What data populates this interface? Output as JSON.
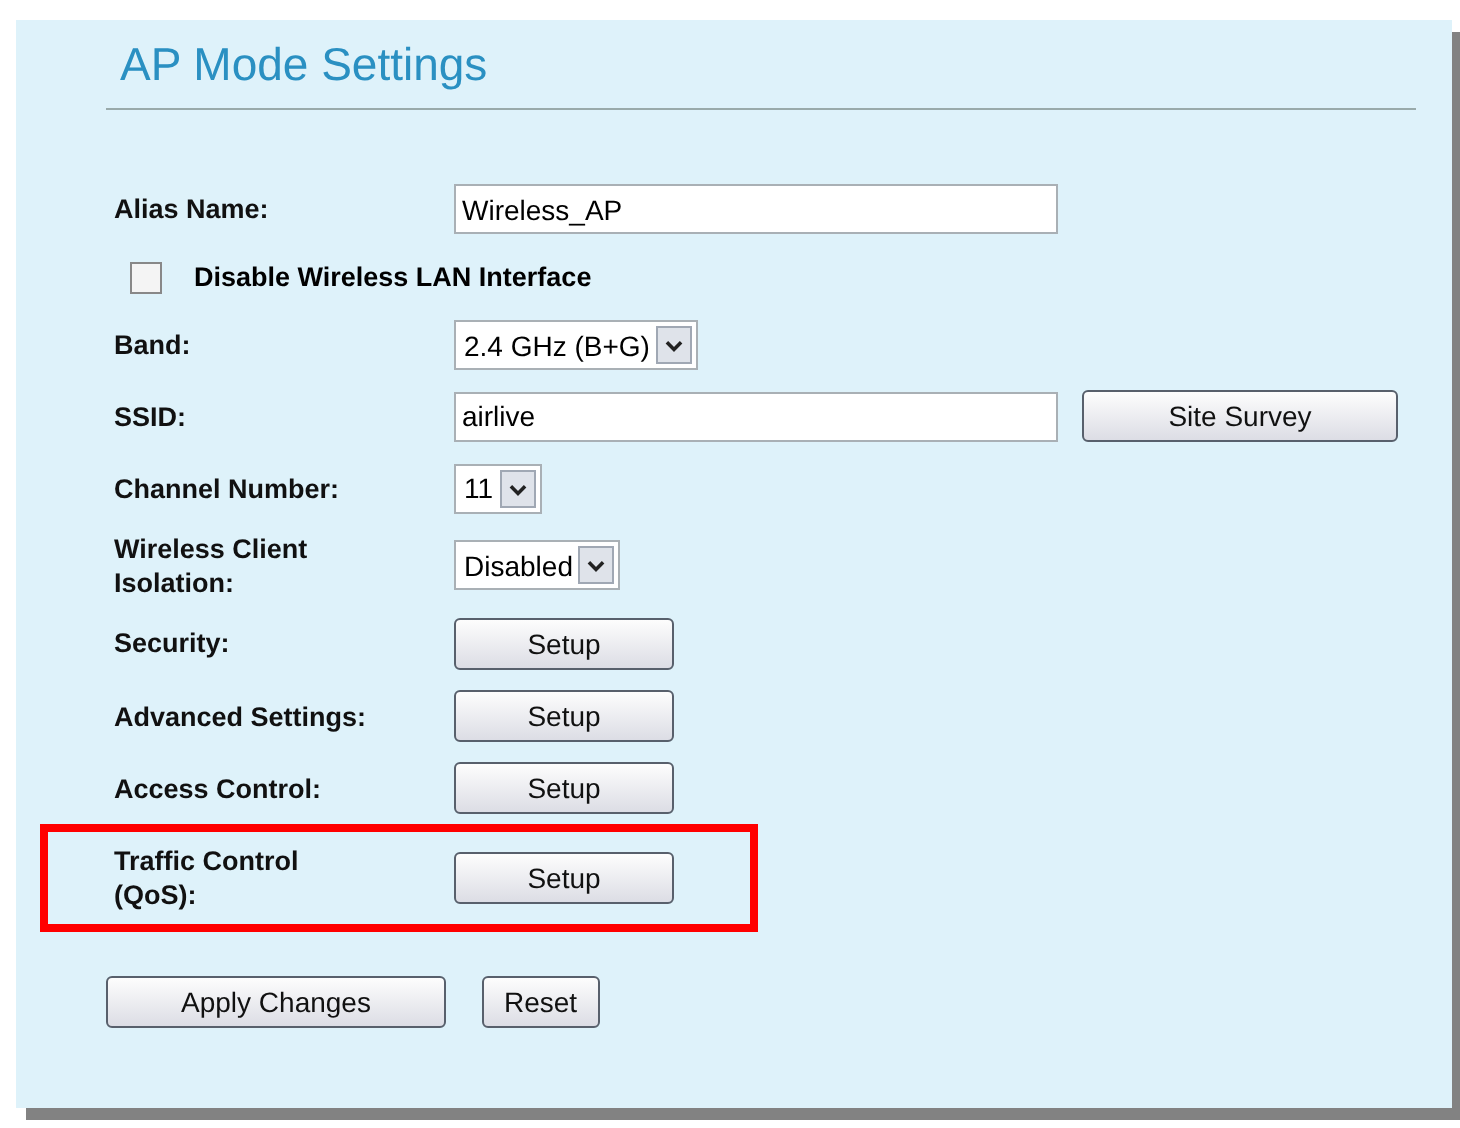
{
  "title": "AP Mode Settings",
  "rows": [
    {
      "kind": "text",
      "label": "Alias Name:",
      "value": "Wireless_AP"
    },
    {
      "kind": "checkbox",
      "label": "Disable Wireless LAN Interface",
      "checked": false
    },
    {
      "kind": "select",
      "label": "Band:",
      "value": "2.4 GHz (B+G)"
    },
    {
      "kind": "text",
      "label": "SSID:",
      "value": "airlive",
      "button": "Site Survey"
    },
    {
      "kind": "select",
      "label": "Channel Number:",
      "value": "11"
    },
    {
      "kind": "select",
      "label": "Wireless Client Isolation:",
      "value": "Disabled"
    },
    {
      "kind": "button",
      "label": "Security:",
      "button": "Setup",
      "highlighted": false
    },
    {
      "kind": "button",
      "label": "Advanced Settings:",
      "button": "Setup",
      "highlighted": false
    },
    {
      "kind": "button",
      "label": "Access Control:",
      "button": "Setup",
      "highlighted": false
    },
    {
      "kind": "button",
      "label": "Traffic Control (QoS):",
      "button": "Setup",
      "highlighted": true
    }
  ],
  "buttons": [
    "Apply Changes",
    "Reset"
  ]
}
